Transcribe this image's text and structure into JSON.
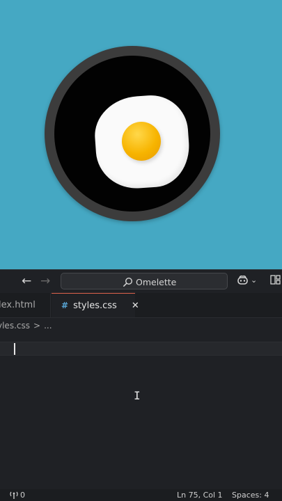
{
  "preview": {
    "background": "#45a8c3",
    "pan_color": "#3c3c3c",
    "egg_white_color": "#fafafa",
    "yolk_color": "#f7b400"
  },
  "titlebar": {
    "back_icon": "arrow-left-icon",
    "forward_icon": "arrow-right-icon",
    "search_label": "Omelette",
    "copilot_icon": "copilot-icon",
    "layout_icon": "layout-icon"
  },
  "tabs": [
    {
      "label": "lex.html",
      "active": false
    },
    {
      "label": "styles.css",
      "icon": "#",
      "active": true,
      "close": "✕"
    }
  ],
  "breadcrumbs": {
    "file": "yles.css",
    "separator": ">",
    "more": "..."
  },
  "status": {
    "ports": "0",
    "position": "Ln 75, Col 1",
    "spaces": "Spaces: 4"
  },
  "colors": {
    "accent": "#e0644c",
    "css_icon": "#58a6d6",
    "editor_bg": "#1f2125"
  }
}
